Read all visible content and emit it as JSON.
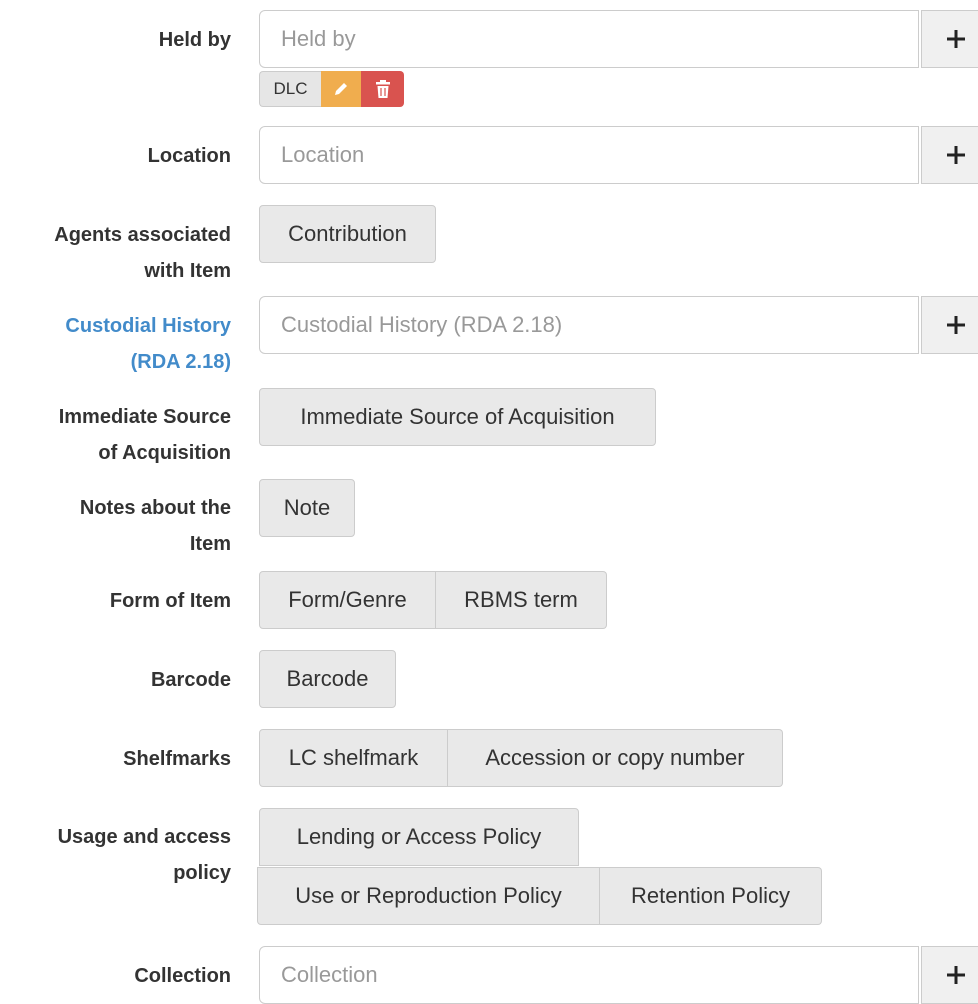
{
  "held_by": {
    "label": "Held by",
    "placeholder": "Held by",
    "tag": "DLC"
  },
  "location": {
    "label": "Location",
    "placeholder": "Location"
  },
  "agents": {
    "label_line1": "Agents associated",
    "label_line2": "with Item",
    "buttons": [
      "Contribution"
    ]
  },
  "custodial_history": {
    "label_line1": "Custodial History",
    "label_line2": "(RDA 2.18)",
    "placeholder": "Custodial History (RDA 2.18)",
    "label_color": "#428bca"
  },
  "immediate_source": {
    "label_line1": "Immediate Source",
    "label_line2": "of Acquisition",
    "buttons": [
      "Immediate Source of Acquisition"
    ]
  },
  "notes": {
    "label_line1": "Notes about the",
    "label_line2": "Item",
    "buttons": [
      "Note"
    ]
  },
  "form_of_item": {
    "label": "Form of Item",
    "buttons": [
      "Form/Genre",
      "RBMS term"
    ]
  },
  "barcode": {
    "label": "Barcode",
    "buttons": [
      "Barcode"
    ]
  },
  "shelfmarks": {
    "label": "Shelfmarks",
    "buttons": [
      "LC shelfmark",
      "Accession or copy number"
    ]
  },
  "usage_policy": {
    "label_line1": "Usage and access",
    "label_line2": "policy",
    "buttons_row1": [
      "Lending or Access Policy"
    ],
    "buttons_row2": [
      "Use or Reproduction Policy",
      "Retention Policy"
    ]
  },
  "collection": {
    "label": "Collection",
    "placeholder": "Collection"
  },
  "icons": {
    "add": "plus-icon",
    "edit": "pencil-icon",
    "delete": "trash-icon"
  },
  "colors": {
    "edit_button": "#f0ad4e",
    "delete_button": "#d9534f",
    "button_bg": "#e9e9e9",
    "border": "#cccccc"
  }
}
